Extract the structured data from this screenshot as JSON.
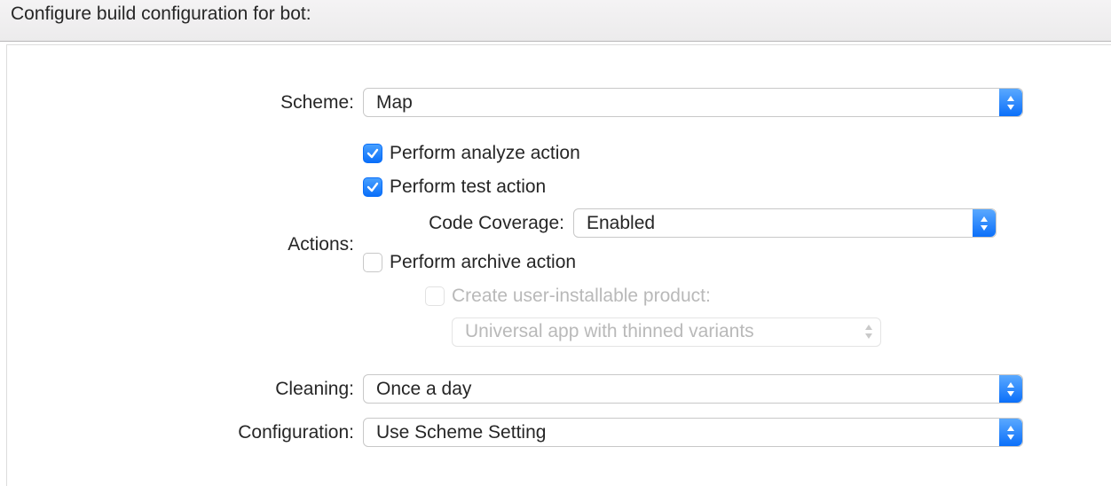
{
  "header": {
    "title": "Configure build configuration for bot:"
  },
  "labels": {
    "scheme": "Scheme:",
    "actions": "Actions:",
    "code_coverage": "Code Coverage:",
    "cleaning": "Cleaning:",
    "configuration": "Configuration:"
  },
  "scheme": {
    "value": "Map"
  },
  "actions": {
    "analyze": {
      "label": "Perform analyze action",
      "checked": true
    },
    "test": {
      "label": "Perform test action",
      "checked": true
    },
    "archive": {
      "label": "Perform archive action",
      "checked": false
    },
    "installable": {
      "label": "Create user-installable product:",
      "checked": false,
      "disabled": true
    },
    "installable_variant": {
      "value": "Universal app with thinned variants",
      "disabled": true
    }
  },
  "code_coverage": {
    "value": "Enabled"
  },
  "cleaning": {
    "value": "Once a day"
  },
  "configuration": {
    "value": "Use Scheme Setting"
  }
}
